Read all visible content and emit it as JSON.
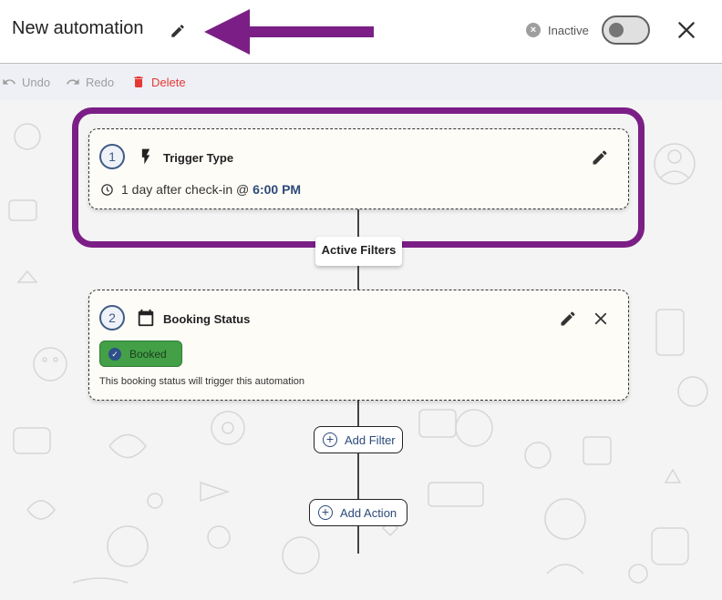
{
  "header": {
    "title": "New automation",
    "status_label": "Inactive",
    "toggle_on": false
  },
  "toolbar": {
    "undo_label": "Undo",
    "redo_label": "Redo",
    "delete_label": "Delete"
  },
  "steps": [
    {
      "number": "1",
      "title": "Trigger Type",
      "detail_prefix": "1 day after check-in @ ",
      "detail_time": "6:00 PM"
    },
    {
      "number": "2",
      "title": "Booking Status",
      "chip_label": "Booked",
      "note": "This booking status will trigger this automation"
    }
  ],
  "active_filters_label": "Active Filters",
  "add_filter_label": "Add Filter",
  "add_action_label": "Add Action",
  "colors": {
    "highlight": "#7b1f86",
    "accent": "#2c4a7a",
    "chip": "#43a047",
    "delete": "#e53935"
  },
  "icons": [
    "pencil-icon",
    "arrow-left-icon",
    "cancel-circle-icon",
    "close-icon",
    "undo-icon",
    "redo-icon",
    "trash-icon",
    "lightning-icon",
    "clock-icon",
    "calendar-icon",
    "check-circle-icon",
    "plus-circle-icon"
  ]
}
